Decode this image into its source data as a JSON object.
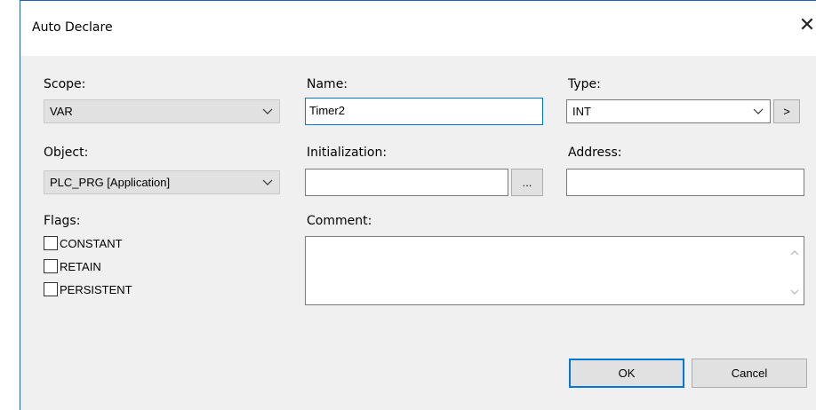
{
  "window": {
    "title": "Auto Declare",
    "close_glyph": "✕"
  },
  "scope": {
    "label": "Scope:",
    "value": "VAR"
  },
  "name": {
    "label": "Name:",
    "value": "Timer2"
  },
  "type": {
    "label": "Type:",
    "value": "INT",
    "browse_label": ">"
  },
  "object": {
    "label": "Object:",
    "value": "PLC_PRG [Application]"
  },
  "initialization": {
    "label": "Initialization:",
    "value": "",
    "browse_label": "..."
  },
  "address": {
    "label": "Address:",
    "value": ""
  },
  "flags": {
    "label": "Flags:",
    "items": [
      {
        "label": "CONSTANT",
        "checked": false
      },
      {
        "label": "RETAIN",
        "checked": false
      },
      {
        "label": "PERSISTENT",
        "checked": false
      }
    ]
  },
  "comment": {
    "label": "Comment:",
    "value": ""
  },
  "buttons": {
    "ok": "OK",
    "cancel": "Cancel"
  },
  "colors": {
    "accent": "#0078d7",
    "dialog_bg": "#f0f0f0",
    "combo_gray": "#e1e1e1"
  }
}
